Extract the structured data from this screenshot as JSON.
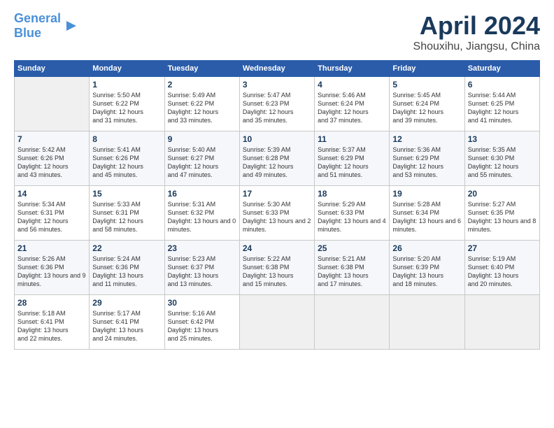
{
  "logo": {
    "text_part1": "General",
    "text_part2": "Blue"
  },
  "header": {
    "title": "April 2024",
    "subtitle": "Shouxihu, Jiangsu, China"
  },
  "weekdays": [
    "Sunday",
    "Monday",
    "Tuesday",
    "Wednesday",
    "Thursday",
    "Friday",
    "Saturday"
  ],
  "weeks": [
    [
      {
        "day": "",
        "sunrise": "",
        "sunset": "",
        "daylight": ""
      },
      {
        "day": "1",
        "sunrise": "Sunrise: 5:50 AM",
        "sunset": "Sunset: 6:22 PM",
        "daylight": "Daylight: 12 hours and 31 minutes."
      },
      {
        "day": "2",
        "sunrise": "Sunrise: 5:49 AM",
        "sunset": "Sunset: 6:22 PM",
        "daylight": "Daylight: 12 hours and 33 minutes."
      },
      {
        "day": "3",
        "sunrise": "Sunrise: 5:47 AM",
        "sunset": "Sunset: 6:23 PM",
        "daylight": "Daylight: 12 hours and 35 minutes."
      },
      {
        "day": "4",
        "sunrise": "Sunrise: 5:46 AM",
        "sunset": "Sunset: 6:24 PM",
        "daylight": "Daylight: 12 hours and 37 minutes."
      },
      {
        "day": "5",
        "sunrise": "Sunrise: 5:45 AM",
        "sunset": "Sunset: 6:24 PM",
        "daylight": "Daylight: 12 hours and 39 minutes."
      },
      {
        "day": "6",
        "sunrise": "Sunrise: 5:44 AM",
        "sunset": "Sunset: 6:25 PM",
        "daylight": "Daylight: 12 hours and 41 minutes."
      }
    ],
    [
      {
        "day": "7",
        "sunrise": "Sunrise: 5:42 AM",
        "sunset": "Sunset: 6:26 PM",
        "daylight": "Daylight: 12 hours and 43 minutes."
      },
      {
        "day": "8",
        "sunrise": "Sunrise: 5:41 AM",
        "sunset": "Sunset: 6:26 PM",
        "daylight": "Daylight: 12 hours and 45 minutes."
      },
      {
        "day": "9",
        "sunrise": "Sunrise: 5:40 AM",
        "sunset": "Sunset: 6:27 PM",
        "daylight": "Daylight: 12 hours and 47 minutes."
      },
      {
        "day": "10",
        "sunrise": "Sunrise: 5:39 AM",
        "sunset": "Sunset: 6:28 PM",
        "daylight": "Daylight: 12 hours and 49 minutes."
      },
      {
        "day": "11",
        "sunrise": "Sunrise: 5:37 AM",
        "sunset": "Sunset: 6:29 PM",
        "daylight": "Daylight: 12 hours and 51 minutes."
      },
      {
        "day": "12",
        "sunrise": "Sunrise: 5:36 AM",
        "sunset": "Sunset: 6:29 PM",
        "daylight": "Daylight: 12 hours and 53 minutes."
      },
      {
        "day": "13",
        "sunrise": "Sunrise: 5:35 AM",
        "sunset": "Sunset: 6:30 PM",
        "daylight": "Daylight: 12 hours and 55 minutes."
      }
    ],
    [
      {
        "day": "14",
        "sunrise": "Sunrise: 5:34 AM",
        "sunset": "Sunset: 6:31 PM",
        "daylight": "Daylight: 12 hours and 56 minutes."
      },
      {
        "day": "15",
        "sunrise": "Sunrise: 5:33 AM",
        "sunset": "Sunset: 6:31 PM",
        "daylight": "Daylight: 12 hours and 58 minutes."
      },
      {
        "day": "16",
        "sunrise": "Sunrise: 5:31 AM",
        "sunset": "Sunset: 6:32 PM",
        "daylight": "Daylight: 13 hours and 0 minutes."
      },
      {
        "day": "17",
        "sunrise": "Sunrise: 5:30 AM",
        "sunset": "Sunset: 6:33 PM",
        "daylight": "Daylight: 13 hours and 2 minutes."
      },
      {
        "day": "18",
        "sunrise": "Sunrise: 5:29 AM",
        "sunset": "Sunset: 6:33 PM",
        "daylight": "Daylight: 13 hours and 4 minutes."
      },
      {
        "day": "19",
        "sunrise": "Sunrise: 5:28 AM",
        "sunset": "Sunset: 6:34 PM",
        "daylight": "Daylight: 13 hours and 6 minutes."
      },
      {
        "day": "20",
        "sunrise": "Sunrise: 5:27 AM",
        "sunset": "Sunset: 6:35 PM",
        "daylight": "Daylight: 13 hours and 8 minutes."
      }
    ],
    [
      {
        "day": "21",
        "sunrise": "Sunrise: 5:26 AM",
        "sunset": "Sunset: 6:36 PM",
        "daylight": "Daylight: 13 hours and 9 minutes."
      },
      {
        "day": "22",
        "sunrise": "Sunrise: 5:24 AM",
        "sunset": "Sunset: 6:36 PM",
        "daylight": "Daylight: 13 hours and 11 minutes."
      },
      {
        "day": "23",
        "sunrise": "Sunrise: 5:23 AM",
        "sunset": "Sunset: 6:37 PM",
        "daylight": "Daylight: 13 hours and 13 minutes."
      },
      {
        "day": "24",
        "sunrise": "Sunrise: 5:22 AM",
        "sunset": "Sunset: 6:38 PM",
        "daylight": "Daylight: 13 hours and 15 minutes."
      },
      {
        "day": "25",
        "sunrise": "Sunrise: 5:21 AM",
        "sunset": "Sunset: 6:38 PM",
        "daylight": "Daylight: 13 hours and 17 minutes."
      },
      {
        "day": "26",
        "sunrise": "Sunrise: 5:20 AM",
        "sunset": "Sunset: 6:39 PM",
        "daylight": "Daylight: 13 hours and 18 minutes."
      },
      {
        "day": "27",
        "sunrise": "Sunrise: 5:19 AM",
        "sunset": "Sunset: 6:40 PM",
        "daylight": "Daylight: 13 hours and 20 minutes."
      }
    ],
    [
      {
        "day": "28",
        "sunrise": "Sunrise: 5:18 AM",
        "sunset": "Sunset: 6:41 PM",
        "daylight": "Daylight: 13 hours and 22 minutes."
      },
      {
        "day": "29",
        "sunrise": "Sunrise: 5:17 AM",
        "sunset": "Sunset: 6:41 PM",
        "daylight": "Daylight: 13 hours and 24 minutes."
      },
      {
        "day": "30",
        "sunrise": "Sunrise: 5:16 AM",
        "sunset": "Sunset: 6:42 PM",
        "daylight": "Daylight: 13 hours and 25 minutes."
      },
      {
        "day": "",
        "sunrise": "",
        "sunset": "",
        "daylight": ""
      },
      {
        "day": "",
        "sunrise": "",
        "sunset": "",
        "daylight": ""
      },
      {
        "day": "",
        "sunrise": "",
        "sunset": "",
        "daylight": ""
      },
      {
        "day": "",
        "sunrise": "",
        "sunset": "",
        "daylight": ""
      }
    ]
  ]
}
